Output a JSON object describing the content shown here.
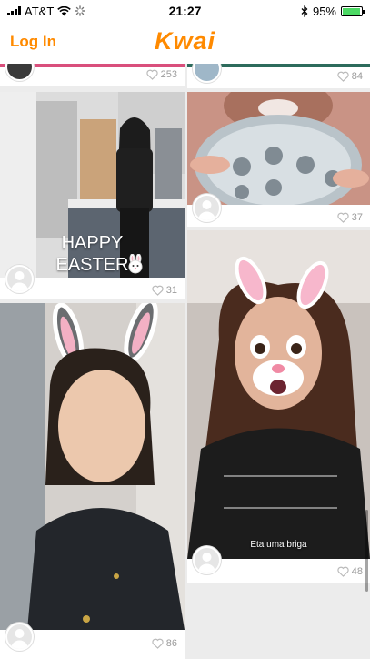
{
  "status_bar": {
    "carrier": "AT&T",
    "time": "21:27",
    "battery": "95%"
  },
  "nav": {
    "login_label": "Log In",
    "logo": "Kwai"
  },
  "feed": [
    {
      "likes": "253"
    },
    {
      "likes": "84"
    },
    {
      "likes": "37"
    },
    {
      "caption": "HAPPY EASTER FOOLS!!!",
      "likes": "31"
    },
    {
      "caption": "Eta uma briga",
      "likes": "48"
    },
    {
      "likes": "86"
    }
  ]
}
